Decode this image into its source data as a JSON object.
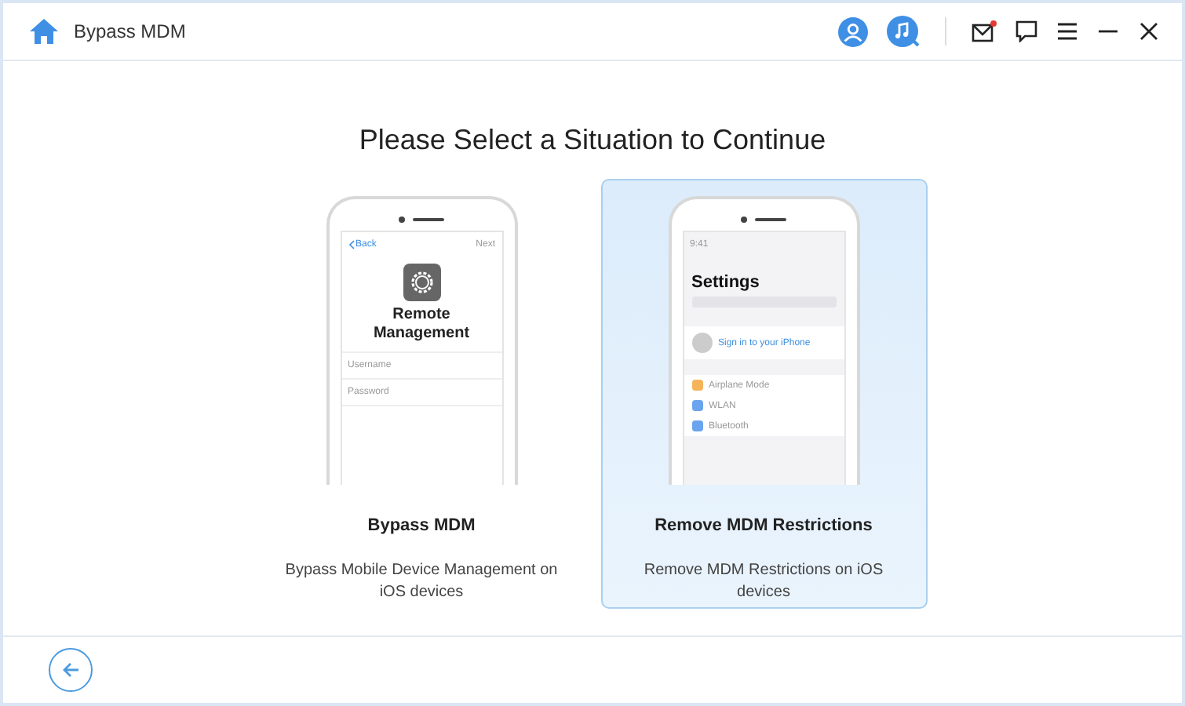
{
  "window": {
    "title": "Bypass MDM"
  },
  "heading": "Please Select a Situation to Continue",
  "options": [
    {
      "kind": "remote",
      "selected": false,
      "title": "Bypass MDM",
      "description": "Bypass Mobile Device Management on iOS devices",
      "screen": {
        "back": "Back",
        "next": "Next",
        "title": "Remote Management",
        "fields": [
          "Username",
          "Password"
        ]
      }
    },
    {
      "kind": "settings",
      "selected": true,
      "title": "Remove MDM Restrictions",
      "description": "Remove MDM Restrictions on iOS devices",
      "screen": {
        "time": "9:41",
        "title": "Settings",
        "account": "Sign in to your iPhone",
        "rows": [
          "Airplane Mode",
          "WLAN",
          "Bluetooth"
        ]
      }
    }
  ]
}
